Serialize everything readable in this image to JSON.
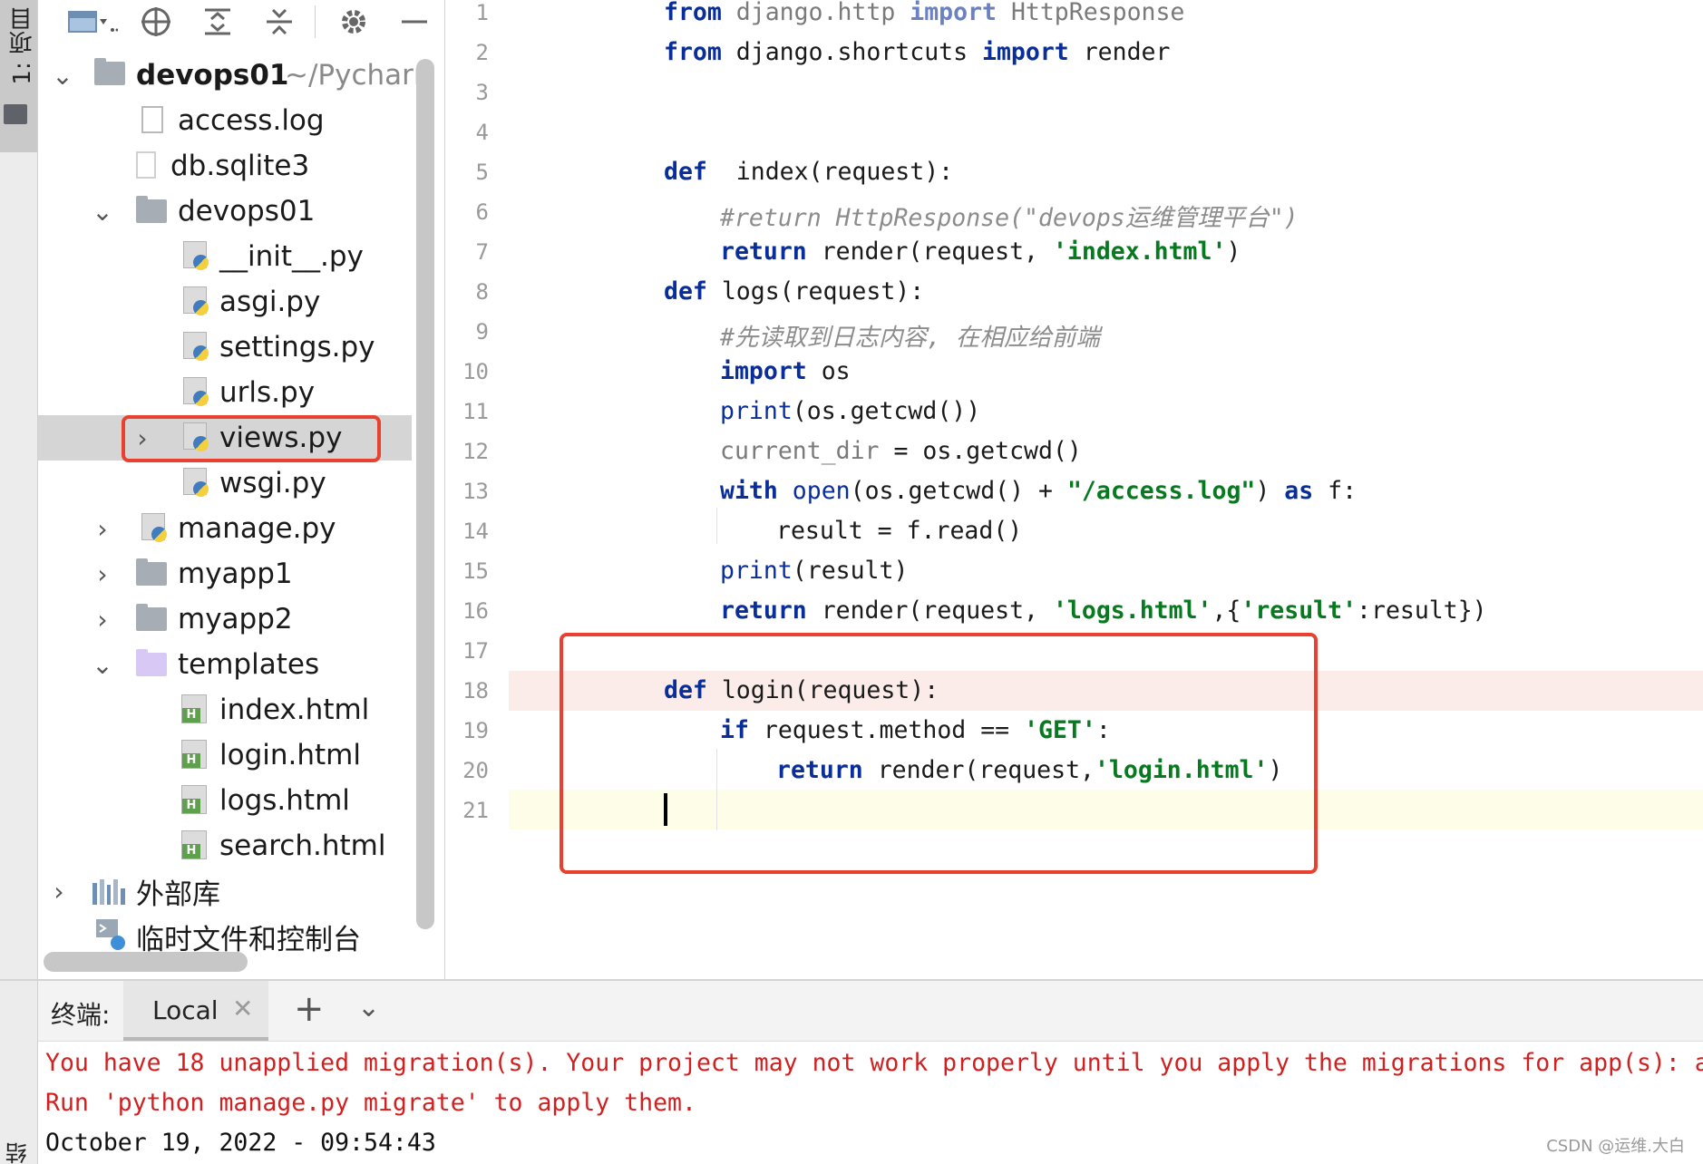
{
  "left_strip": {
    "project_tab": "1: 项目",
    "bottom_tab": "结构"
  },
  "project_panel": {
    "tree": [
      {
        "label": "devops01",
        "path_hint": "~/Pycharı",
        "type": "project-root",
        "expanded": true
      },
      {
        "label": "access.log",
        "type": "file"
      },
      {
        "label": "db.sqlite3",
        "type": "file"
      },
      {
        "label": "devops01",
        "type": "folder",
        "expanded": true
      },
      {
        "label": "__init__.py",
        "type": "python"
      },
      {
        "label": "asgi.py",
        "type": "python"
      },
      {
        "label": "settings.py",
        "type": "python"
      },
      {
        "label": "urls.py",
        "type": "python"
      },
      {
        "label": "views.py",
        "type": "python",
        "selected": true
      },
      {
        "label": "wsgi.py",
        "type": "python"
      },
      {
        "label": "manage.py",
        "type": "python"
      },
      {
        "label": "myapp1",
        "type": "folder"
      },
      {
        "label": "myapp2",
        "type": "folder"
      },
      {
        "label": "templates",
        "type": "folder-purple",
        "expanded": true
      },
      {
        "label": "index.html",
        "type": "html"
      },
      {
        "label": "login.html",
        "type": "html"
      },
      {
        "label": "logs.html",
        "type": "html"
      },
      {
        "label": "search.html",
        "type": "html"
      },
      {
        "label": "外部库",
        "type": "library"
      },
      {
        "label": "临时文件和控制台",
        "type": "scratch"
      }
    ]
  },
  "editor": {
    "line_numbers": [
      "1",
      "2",
      "3",
      "4",
      "5",
      "6",
      "7",
      "8",
      "9",
      "10",
      "11",
      "12",
      "13",
      "14",
      "15",
      "16",
      "17",
      "18",
      "19",
      "20",
      "21"
    ],
    "lines": {
      "l1": {
        "a": "from",
        "b": " django.http ",
        "c": "import",
        "d": " HttpResponse"
      },
      "l2": {
        "a": "from",
        "b": " django.shortcuts ",
        "c": "import",
        "d": " render"
      },
      "l5": {
        "a": "def",
        "b": "  index(request):"
      },
      "l6": {
        "a": "#return HttpResponse(\"devops运维管理平台\")"
      },
      "l7": {
        "a": "return",
        "b": " render(request, ",
        "c": "'index.html'",
        "d": ")"
      },
      "l8": {
        "a": "def",
        "b": " logs(request):"
      },
      "l9": {
        "a": "#先读取到日志内容, 在相应给前端"
      },
      "l10": {
        "a": "import",
        "b": " os"
      },
      "l11": {
        "a": "print",
        "b": "(os.getcwd())"
      },
      "l12": {
        "a": "current_dir",
        "b": " = os.getcwd()"
      },
      "l13": {
        "a": "with",
        "b": " ",
        "c": "open",
        "d": "(os.getcwd() + ",
        "e": "\"/access.log\"",
        "f": ") ",
        "g": "as",
        "h": " f:"
      },
      "l14": {
        "a": "result = f.read()"
      },
      "l15": {
        "a": "print",
        "b": "(result)"
      },
      "l16": {
        "a": "return",
        "b": " render(request, ",
        "c": "'logs.html'",
        "d": ",{",
        "e": "'result'",
        "f": ":result})"
      },
      "l18": {
        "a": "def",
        "b": " login(request):"
      },
      "l19": {
        "a": "if",
        "b": " request.method == ",
        "c": "'GET'",
        "d": ":"
      },
      "l20": {
        "a": "return",
        "b": " render(request,",
        "c": "'login.html'",
        "d": ")"
      }
    }
  },
  "terminal": {
    "title": "终端:",
    "tab_label": "Local",
    "lines": [
      "You have 18 unapplied migration(s). Your project may not work properly until you apply the migrations for app(s): a",
      "Run 'python manage.py migrate' to apply them.",
      "October 19, 2022 - 09:54:43"
    ]
  },
  "watermark": "CSDN @运维.大白",
  "colors": {
    "keyword": "#0a2e99",
    "string": "#077a20",
    "comment": "#8c8c8c",
    "error": "#d21f1f",
    "annotation_box": "#e8412f"
  }
}
